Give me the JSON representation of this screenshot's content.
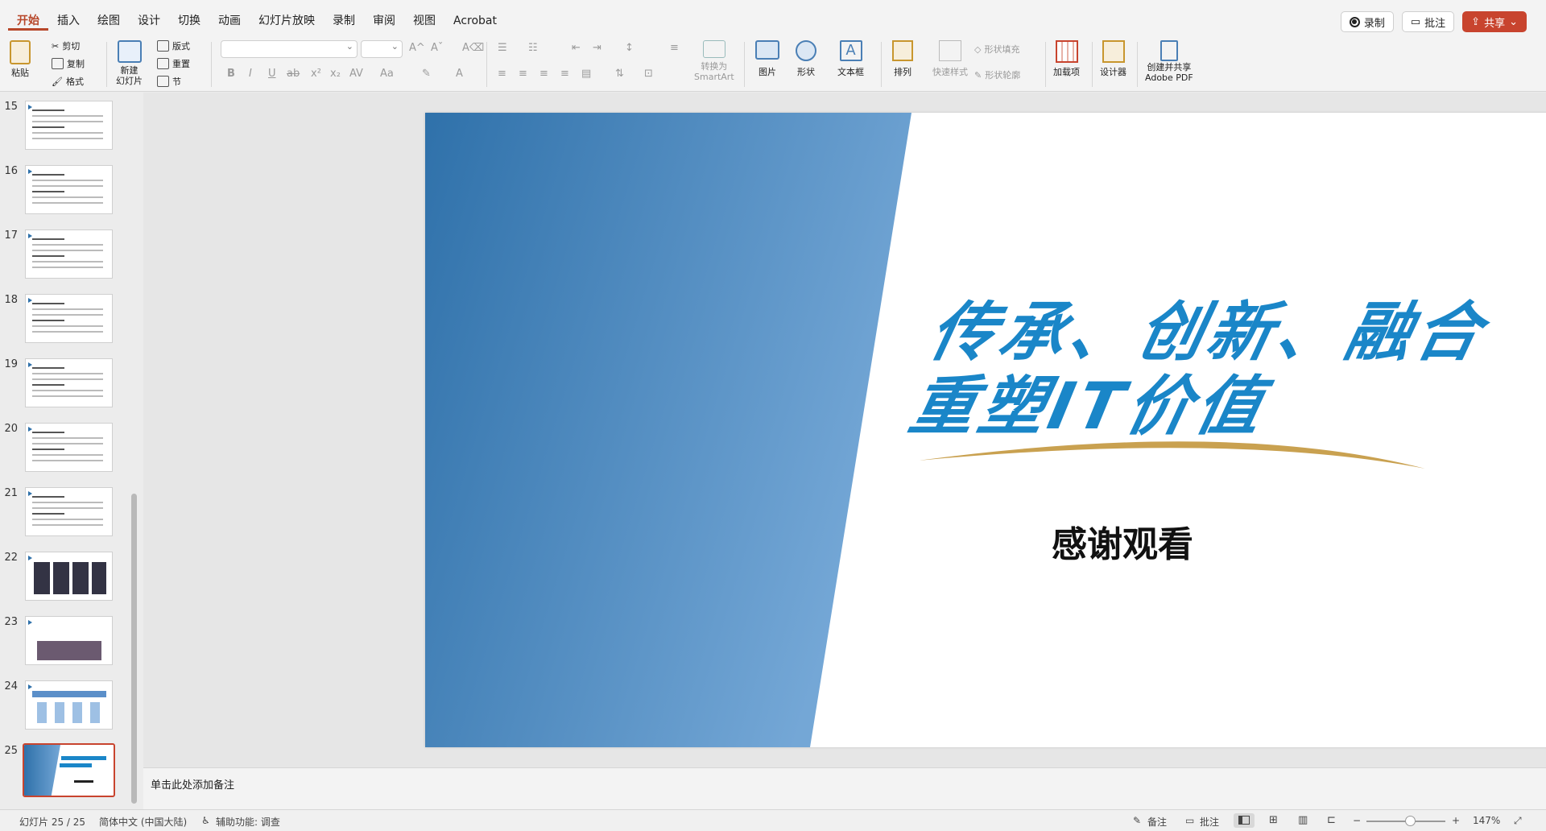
{
  "tabs": [
    "开始",
    "插入",
    "绘图",
    "设计",
    "切换",
    "动画",
    "幻灯片放映",
    "录制",
    "审阅",
    "视图",
    "Acrobat"
  ],
  "active_tab": 0,
  "top_actions": {
    "record": "录制",
    "comment": "批注",
    "share": "共享"
  },
  "ribbon": {
    "paste": "粘贴",
    "cut": "剪切",
    "copy": "复制",
    "format": "格式",
    "new_slide_1": "新建",
    "new_slide_2": "幻灯片",
    "layout": "版式",
    "reset": "重置",
    "section": "节",
    "smartart_1": "转换为",
    "smartart_2": "SmartArt",
    "picture": "图片",
    "shape": "形状",
    "textbox": "文本框",
    "arrange": "排列",
    "quick_style": "快速样式",
    "shape_fill": "形状填充",
    "shape_outline": "形状轮廓",
    "addins": "加载项",
    "designer": "设计器",
    "pdf_1": "创建并共享",
    "pdf_2": "Adobe PDF",
    "font_btns": [
      "B",
      "I",
      "U",
      "ab",
      "x²",
      "x₂",
      "AV",
      "Aa",
      "A"
    ]
  },
  "slide_numbers": [
    15,
    16,
    17,
    18,
    19,
    20,
    21,
    22,
    23,
    24,
    25
  ],
  "selected_slide": 25,
  "slide": {
    "headline_1": "传承、创新、融合",
    "headline_2": "重塑IT价值",
    "thanks": "感谢观看",
    "accent_blue": "#1a86c8",
    "gold": "#c9a150"
  },
  "notes_placeholder": "单击此处添加备注",
  "status": {
    "slide_counter": "幻灯片 25 / 25",
    "language": "简体中文 (中国大陆)",
    "accessibility": "辅助功能: 调查",
    "notes": "备注",
    "comments": "批注",
    "zoom": "147%"
  }
}
